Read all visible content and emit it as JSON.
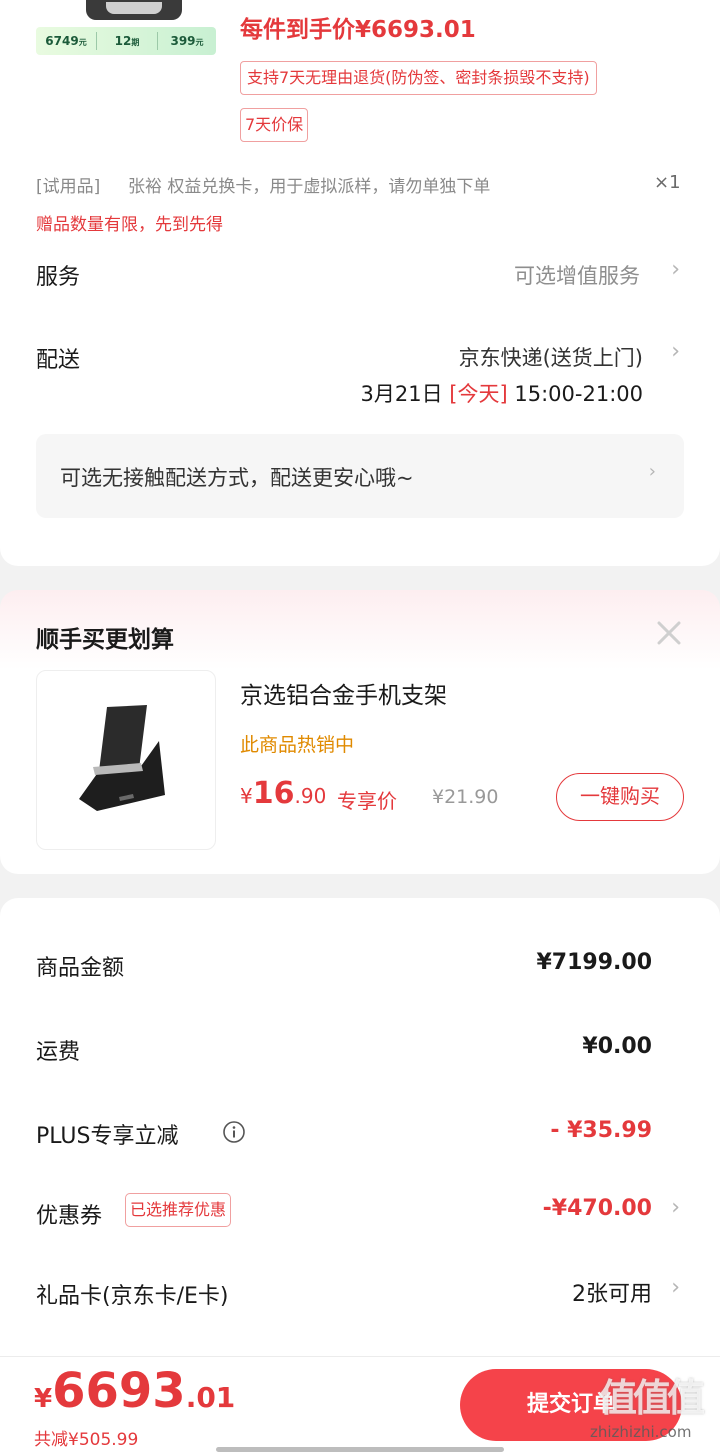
{
  "product": {
    "promo_badge": {
      "price1": "6749",
      "unit1": "元",
      "period": "12",
      "unit2": "期",
      "price2": "399",
      "unit3": "元"
    },
    "net_price": "每件到手价¥6693.01",
    "return_tag": "支持7天无理由退货(防伪签、密封条损毁不支持)",
    "price_protect_tag": "7天价保"
  },
  "gift": {
    "label": "[试用品]",
    "name": "张裕 权益兑换卡，用于虚拟派样，请勿单独下单",
    "qty": "×1",
    "notice": "赠品数量有限，先到先得"
  },
  "service": {
    "label": "服务",
    "value": "可选增值服务"
  },
  "delivery": {
    "label": "配送",
    "method": "京东快递(送货上门)",
    "date": "3月21日",
    "today": "[今天]",
    "time": "15:00-21:00",
    "contactless": "可选无接触配送方式，配送更安心哦~"
  },
  "addon": {
    "title": "顺手买更划算",
    "item_name": "京选铝合金手机支架",
    "hot": "此商品热销中",
    "currency": "¥",
    "price_int": "16",
    "price_dec": ".90",
    "price_label": "专享价",
    "orig_price": "¥21.90",
    "buy_button": "一键购买"
  },
  "summary": {
    "goods_label": "商品金额",
    "goods_value": "¥7199.00",
    "freight_label": "运费",
    "freight_value": "¥0.00",
    "plus_label": "PLUS专享立减",
    "plus_value": "- ¥35.99",
    "coupon_label": "优惠券",
    "coupon_tag": "已选推荐优惠",
    "coupon_value": "-¥470.00",
    "giftcard_label": "礼品卡(京东卡/E卡)",
    "giftcard_value": "2张可用"
  },
  "footer": {
    "currency": "¥",
    "total_int": "6693",
    "total_dec": ".01",
    "saved": "共减¥505.99",
    "submit": "提交订单"
  },
  "watermark": {
    "logo": "值值值",
    "url": "zhizhizhi.com"
  },
  "colors": {
    "accent": "#e4393c",
    "hot": "#e08a00",
    "submit_bg": "#f5434a"
  }
}
